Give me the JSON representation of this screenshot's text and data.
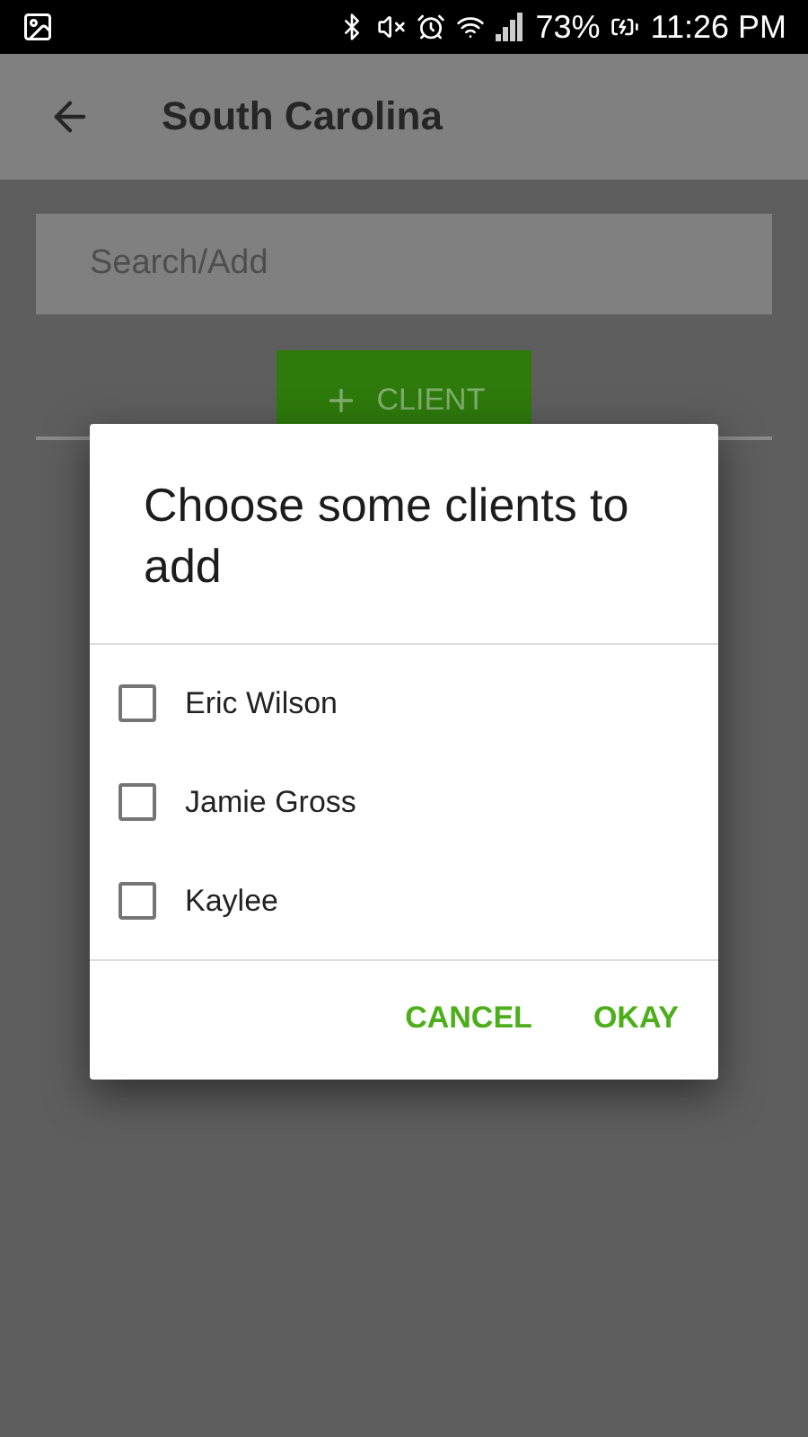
{
  "status_bar": {
    "battery": "73%",
    "time": "11:26 PM"
  },
  "app_bar": {
    "title": "South Carolina"
  },
  "search": {
    "placeholder": "Search/Add"
  },
  "add_button": {
    "label": "CLIENT"
  },
  "dialog": {
    "title": "Choose some clients to add",
    "options": [
      {
        "label": "Eric Wilson",
        "checked": false
      },
      {
        "label": "Jamie Gross",
        "checked": false
      },
      {
        "label": "Kaylee",
        "checked": false
      }
    ],
    "buttons": [
      "CANCEL",
      "OKAY"
    ]
  }
}
